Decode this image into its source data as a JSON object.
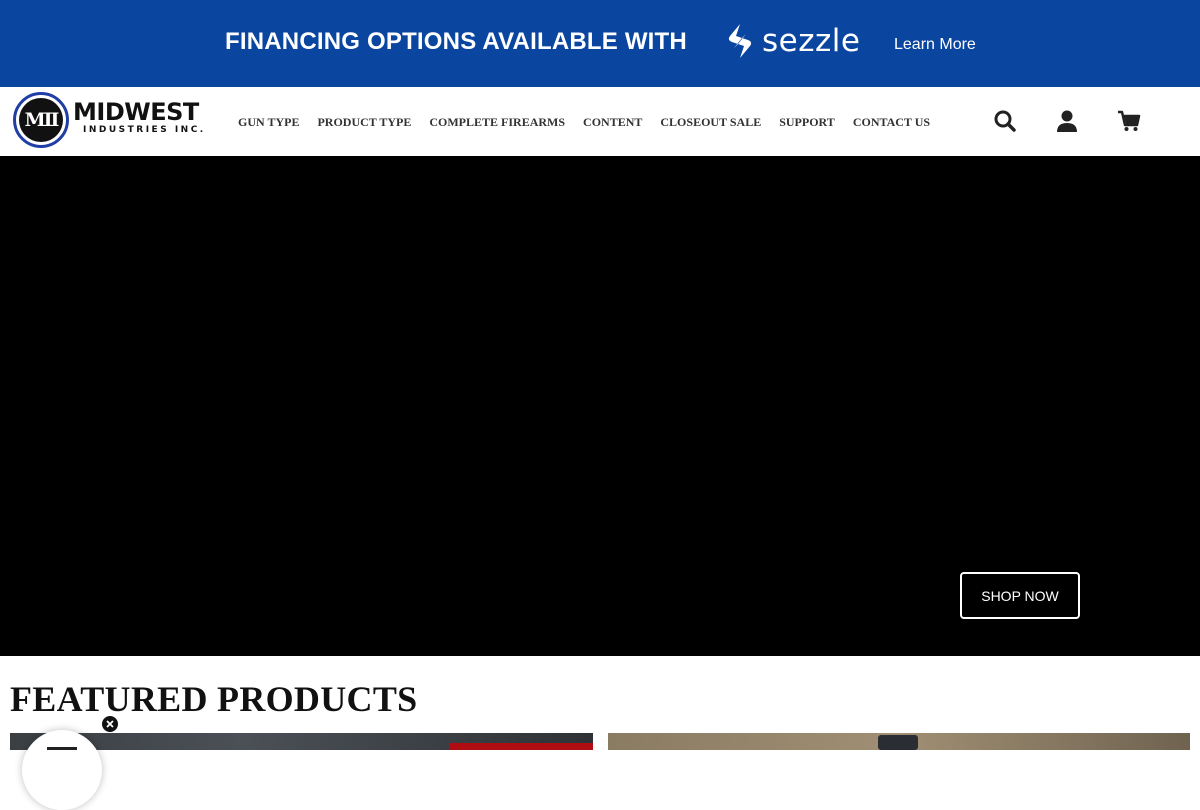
{
  "promo": {
    "text": "FINANCING OPTIONS AVAILABLE WITH",
    "brand": "sezzle",
    "link": "Learn More",
    "bg_color": "#0a45a0"
  },
  "logo": {
    "emblem": "MII",
    "name": "MIDWEST",
    "sub": "INDUSTRIES INC."
  },
  "nav": {
    "items": [
      "GUN TYPE",
      "PRODUCT TYPE",
      "COMPLETE FIREARMS",
      "CONTENT",
      "CLOSEOUT SALE",
      "SUPPORT",
      "CONTACT US"
    ]
  },
  "header_icons": [
    "search-icon",
    "account-icon",
    "cart-icon"
  ],
  "hero": {
    "cta": "SHOP NOW"
  },
  "featured": {
    "title": "FEATURED PRODUCTS"
  },
  "colors": {
    "accent": "#0a45a0",
    "sale_badge": "#b00d12"
  }
}
